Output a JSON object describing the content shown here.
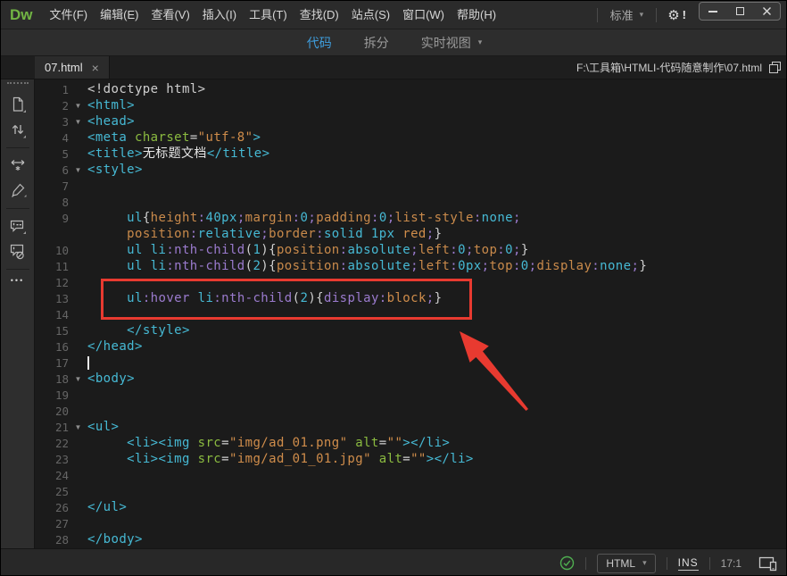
{
  "window": {
    "logo": "Dw",
    "menus": [
      "文件(F)",
      "编辑(E)",
      "查看(V)",
      "插入(I)",
      "工具(T)",
      "查找(D)",
      "站点(S)",
      "窗口(W)",
      "帮助(H)"
    ],
    "workspace": "标准",
    "notification": "!",
    "controls": [
      "minimize-icon",
      "maximize-icon",
      "close-icon"
    ]
  },
  "icons": {
    "chevron_down": "▾",
    "gear": "⚙",
    "ellipsis": "•••"
  },
  "doc_toolbar": {
    "code": "代码",
    "split": "拆分",
    "live": "实时视图"
  },
  "tab_bar": {
    "title": "07.html",
    "close": "×",
    "path": "F:\\工具箱\\HTMLI-代码随意制作\\07.html"
  },
  "sidebar": {
    "icons": [
      "file-icon",
      "move-up-down-icon",
      "wrap-tag-icon",
      "format-source-icon",
      "apply-comment-icon",
      "remove-comment-icon",
      "more-icon"
    ]
  },
  "status_bar": {
    "doc_type": "HTML",
    "insert_mode": "INS",
    "cursor_position": "17:1"
  },
  "colors": {
    "accent_blue": "#3f9ede",
    "brand_green": "#72b544",
    "annotation_red": "#e83a30",
    "tag_teal": "#46b9d4",
    "attr_green": "#8bbb40",
    "string_orange": "#d08d4b",
    "pseudo_purple": "#9b7bce"
  },
  "code": {
    "rows": [
      {
        "n": 1,
        "t": [
          [
            "p",
            "<!doctype html>"
          ]
        ]
      },
      {
        "n": 2,
        "fold": true,
        "t": [
          [
            "t",
            "<html>"
          ]
        ]
      },
      {
        "n": 3,
        "fold": true,
        "t": [
          [
            "t",
            "<head>"
          ]
        ]
      },
      {
        "n": 4,
        "t": [
          [
            "t",
            "<meta"
          ],
          [
            "p",
            " "
          ],
          [
            "a",
            "charset"
          ],
          [
            "p",
            "="
          ],
          [
            "s",
            "\"utf-8\""
          ],
          [
            "t",
            ">"
          ]
        ]
      },
      {
        "n": 5,
        "t": [
          [
            "t",
            "<title>"
          ],
          [
            "w",
            "无标题文档"
          ],
          [
            "t",
            "</title>"
          ]
        ]
      },
      {
        "n": 6,
        "fold": true,
        "t": [
          [
            "t",
            "<style>"
          ]
        ]
      },
      {
        "n": 7,
        "t": []
      },
      {
        "n": 8,
        "t": []
      },
      {
        "n": 9,
        "t": [
          [
            "p",
            "     "
          ],
          [
            "t",
            "ul"
          ],
          [
            "p",
            "{"
          ],
          [
            "o",
            "height"
          ],
          [
            "u",
            ":"
          ],
          [
            "v",
            "40px"
          ],
          [
            "u",
            ";"
          ],
          [
            "o",
            "margin"
          ],
          [
            "u",
            ":"
          ],
          [
            "v",
            "0"
          ],
          [
            "u",
            ";"
          ],
          [
            "o",
            "padding"
          ],
          [
            "u",
            ":"
          ],
          [
            "v",
            "0"
          ],
          [
            "u",
            ";"
          ],
          [
            "o",
            "list-style"
          ],
          [
            "u",
            ":"
          ],
          [
            "v",
            "none"
          ],
          [
            "u",
            ";"
          ]
        ]
      },
      {
        "n": null,
        "t": [
          [
            "p",
            "     "
          ],
          [
            "o",
            "position"
          ],
          [
            "u",
            ":"
          ],
          [
            "v",
            "relative"
          ],
          [
            "u",
            ";"
          ],
          [
            "o",
            "border"
          ],
          [
            "u",
            ":"
          ],
          [
            "v",
            "solid 1px "
          ],
          [
            "s",
            "red"
          ],
          [
            "u",
            ";"
          ],
          [
            "p",
            "}"
          ]
        ]
      },
      {
        "n": 10,
        "t": [
          [
            "p",
            "     "
          ],
          [
            "t",
            "ul li"
          ],
          [
            "u",
            ":nth-child"
          ],
          [
            "p",
            "("
          ],
          [
            "v",
            "1"
          ],
          [
            "p",
            "){"
          ],
          [
            "o",
            "position"
          ],
          [
            "u",
            ":"
          ],
          [
            "v",
            "absolute"
          ],
          [
            "u",
            ";"
          ],
          [
            "o",
            "left"
          ],
          [
            "u",
            ":"
          ],
          [
            "v",
            "0"
          ],
          [
            "u",
            ";"
          ],
          [
            "o",
            "top"
          ],
          [
            "u",
            ":"
          ],
          [
            "v",
            "0"
          ],
          [
            "u",
            ";"
          ],
          [
            "p",
            "}"
          ]
        ]
      },
      {
        "n": 11,
        "t": [
          [
            "p",
            "     "
          ],
          [
            "t",
            "ul li"
          ],
          [
            "u",
            ":nth-child"
          ],
          [
            "p",
            "("
          ],
          [
            "v",
            "2"
          ],
          [
            "p",
            "){"
          ],
          [
            "o",
            "position"
          ],
          [
            "u",
            ":"
          ],
          [
            "v",
            "absolute"
          ],
          [
            "u",
            ";"
          ],
          [
            "o",
            "left"
          ],
          [
            "u",
            ":"
          ],
          [
            "v",
            "0px"
          ],
          [
            "u",
            ";"
          ],
          [
            "o",
            "top"
          ],
          [
            "u",
            ":"
          ],
          [
            "v",
            "0"
          ],
          [
            "u",
            ";"
          ],
          [
            "o",
            "display"
          ],
          [
            "u",
            ":"
          ],
          [
            "v",
            "none"
          ],
          [
            "u",
            ";"
          ],
          [
            "p",
            "}"
          ]
        ]
      },
      {
        "n": 12,
        "t": []
      },
      {
        "n": 13,
        "t": [
          [
            "p",
            "     "
          ],
          [
            "t",
            "ul"
          ],
          [
            "u",
            ":hover"
          ],
          [
            "p",
            " "
          ],
          [
            "t",
            "li"
          ],
          [
            "u",
            ":nth-child"
          ],
          [
            "p",
            "("
          ],
          [
            "v",
            "2"
          ],
          [
            "p",
            "){"
          ],
          [
            "u",
            "display"
          ],
          [
            "u",
            ":"
          ],
          [
            "s",
            "block"
          ],
          [
            "u",
            ";"
          ],
          [
            "p",
            "}"
          ]
        ]
      },
      {
        "n": 14,
        "t": []
      },
      {
        "n": 15,
        "t": [
          [
            "p",
            "     "
          ],
          [
            "t",
            "</style>"
          ]
        ]
      },
      {
        "n": 16,
        "t": [
          [
            "t",
            "</head>"
          ]
        ]
      },
      {
        "n": 17,
        "cursor": true,
        "t": []
      },
      {
        "n": 18,
        "fold": true,
        "t": [
          [
            "t",
            "<body>"
          ]
        ]
      },
      {
        "n": 19,
        "t": []
      },
      {
        "n": 20,
        "t": []
      },
      {
        "n": 21,
        "fold": true,
        "t": [
          [
            "t",
            "<ul>"
          ]
        ]
      },
      {
        "n": 22,
        "t": [
          [
            "p",
            "     "
          ],
          [
            "t",
            "<li><img"
          ],
          [
            "p",
            " "
          ],
          [
            "a",
            "src"
          ],
          [
            "p",
            "="
          ],
          [
            "s",
            "\"img/ad_01.png\""
          ],
          [
            "p",
            " "
          ],
          [
            "a",
            "alt"
          ],
          [
            "p",
            "="
          ],
          [
            "s",
            "\"\""
          ],
          [
            "t",
            "></li>"
          ]
        ]
      },
      {
        "n": 23,
        "t": [
          [
            "p",
            "     "
          ],
          [
            "t",
            "<li><img"
          ],
          [
            "p",
            " "
          ],
          [
            "a",
            "src"
          ],
          [
            "p",
            "="
          ],
          [
            "s",
            "\"img/ad_01_01.jpg\""
          ],
          [
            "p",
            " "
          ],
          [
            "a",
            "alt"
          ],
          [
            "p",
            "="
          ],
          [
            "s",
            "\"\""
          ],
          [
            "t",
            "></li>"
          ]
        ]
      },
      {
        "n": 24,
        "t": []
      },
      {
        "n": 25,
        "t": []
      },
      {
        "n": 26,
        "t": [
          [
            "t",
            "</ul>"
          ]
        ]
      },
      {
        "n": 27,
        "t": []
      },
      {
        "n": 28,
        "t": [
          [
            "t",
            "</body>"
          ]
        ]
      }
    ]
  }
}
